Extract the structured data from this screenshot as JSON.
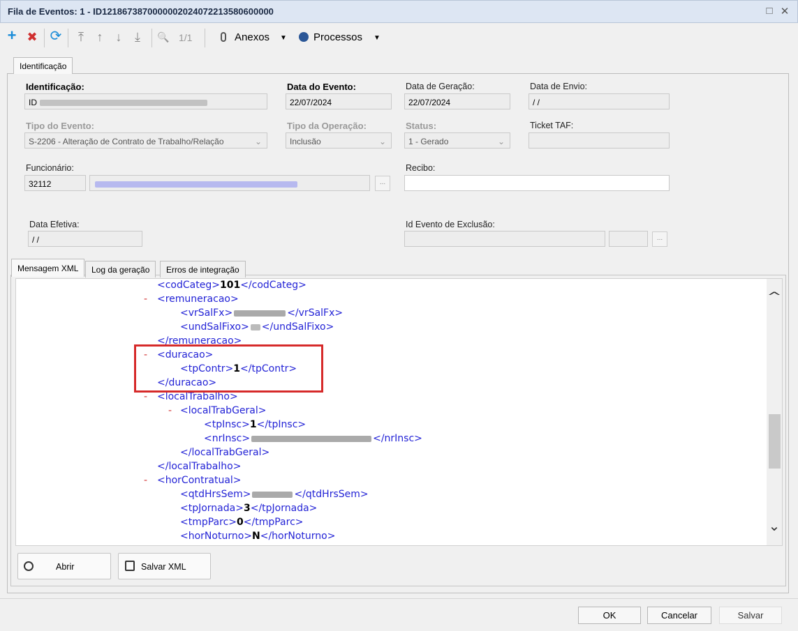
{
  "window": {
    "title": "Fila de Eventos: 1 - ID1218673870000002024072213580600000",
    "maximize_glyph": "□",
    "close_glyph": "✕"
  },
  "toolbar": {
    "add_icon": "+",
    "delete_icon": "✖",
    "refresh_icon": "⟳",
    "first_icon": "⤒",
    "up_icon": "↑",
    "down_icon": "↓",
    "last_icon": "⤓",
    "search_icon": "🔍",
    "page_indicator": "1/1",
    "anexos_label": "Anexos",
    "processos_label": "Processos",
    "dropdown_glyph": "▼",
    "colors": {
      "add": "#1a8cd8",
      "delete": "#d03030",
      "refresh": "#1a8cd8"
    }
  },
  "tabs": {
    "top": [
      {
        "label": "Identificação"
      }
    ],
    "bottom": [
      {
        "label": "Mensagem XML"
      },
      {
        "label": "Log da geração"
      },
      {
        "label": "Erros de integração"
      }
    ]
  },
  "form": {
    "identificacao": {
      "label": "Identificação:",
      "value": "ID"
    },
    "data_evento": {
      "label": "Data do Evento:",
      "value": "22/07/2024"
    },
    "data_geracao": {
      "label": "Data de Geração:",
      "value": "22/07/2024"
    },
    "data_envio": {
      "label": "Data de Envio:",
      "value": " / /"
    },
    "tipo_evento": {
      "label": "Tipo do Evento:",
      "value": "S-2206 - Alteração de Contrato de Trabalho/Relação"
    },
    "tipo_operacao": {
      "label": "Tipo da Operação:",
      "value": "Inclusão"
    },
    "status": {
      "label": "Status:",
      "value": "1 - Gerado"
    },
    "ticket_taf": {
      "label": "Ticket TAF:",
      "value": ""
    },
    "funcionario": {
      "label": "Funcionário:",
      "code": "32112"
    },
    "recibo": {
      "label": "Recibo:",
      "value": ""
    },
    "data_efetiva": {
      "label": "Data Efetiva:",
      "value": " / /"
    },
    "id_evento_exclusao": {
      "label": "Id Evento de Exclusão:",
      "value": ""
    },
    "ellipsis": "..."
  },
  "xml": {
    "dash": "-",
    "codCateg_open": "<codCateg>",
    "codCateg_val": "101",
    "codCateg_close": "</codCateg>",
    "remuneracao_open": "<remuneracao>",
    "vrSalFx_open": "<vrSalFx>",
    "vrSalFx_close": "</vrSalFx>",
    "undSalFixo_open": "<undSalFixo>",
    "undSalFixo_close": "</undSalFixo>",
    "remuneracao_close": "</remuneracao>",
    "duracao_open": "<duracao>",
    "tpContr_open": "<tpContr>",
    "tpContr_val": "1",
    "tpContr_close": "</tpContr>",
    "duracao_close": "</duracao>",
    "localTrabalho_open": "<localTrabalho>",
    "localTrabGeral_open": "<localTrabGeral>",
    "tpInsc_open": "<tpInsc>",
    "tpInsc_val": "1",
    "tpInsc_close": "</tpInsc>",
    "nrInsc_open": "<nrInsc>",
    "nrInsc_close": "</nrInsc>",
    "localTrabGeral_close": "</localTrabGeral>",
    "localTrabalho_close": "</localTrabalho>",
    "horContratual_open": "<horContratual>",
    "qtdHrsSem_open": "<qtdHrsSem>",
    "qtdHrsSem_close": "</qtdHrsSem>",
    "tpJornada_open": "<tpJornada>",
    "tpJornada_val": "3",
    "tpJornada_close": "</tpJornada>",
    "tmpParc_open": "<tmpParc>",
    "tmpParc_val": "0",
    "tmpParc_close": "</tmpParc>",
    "horNoturno_open": "<horNoturno>",
    "horNoturno_val": "N",
    "horNoturno_close": "</horNoturno>",
    "colors": {
      "tag": "#2323d6",
      "dash": "#d23030",
      "highlight": "#d62a2a"
    }
  },
  "scroll": {
    "up_glyph": "^",
    "down_glyph": "⌄"
  },
  "bottom_buttons": {
    "abrir": "Abrir",
    "salvar_xml": "Salvar XML"
  },
  "footer": {
    "ok": "OK",
    "cancelar": "Cancelar",
    "salvar": "Salvar"
  }
}
